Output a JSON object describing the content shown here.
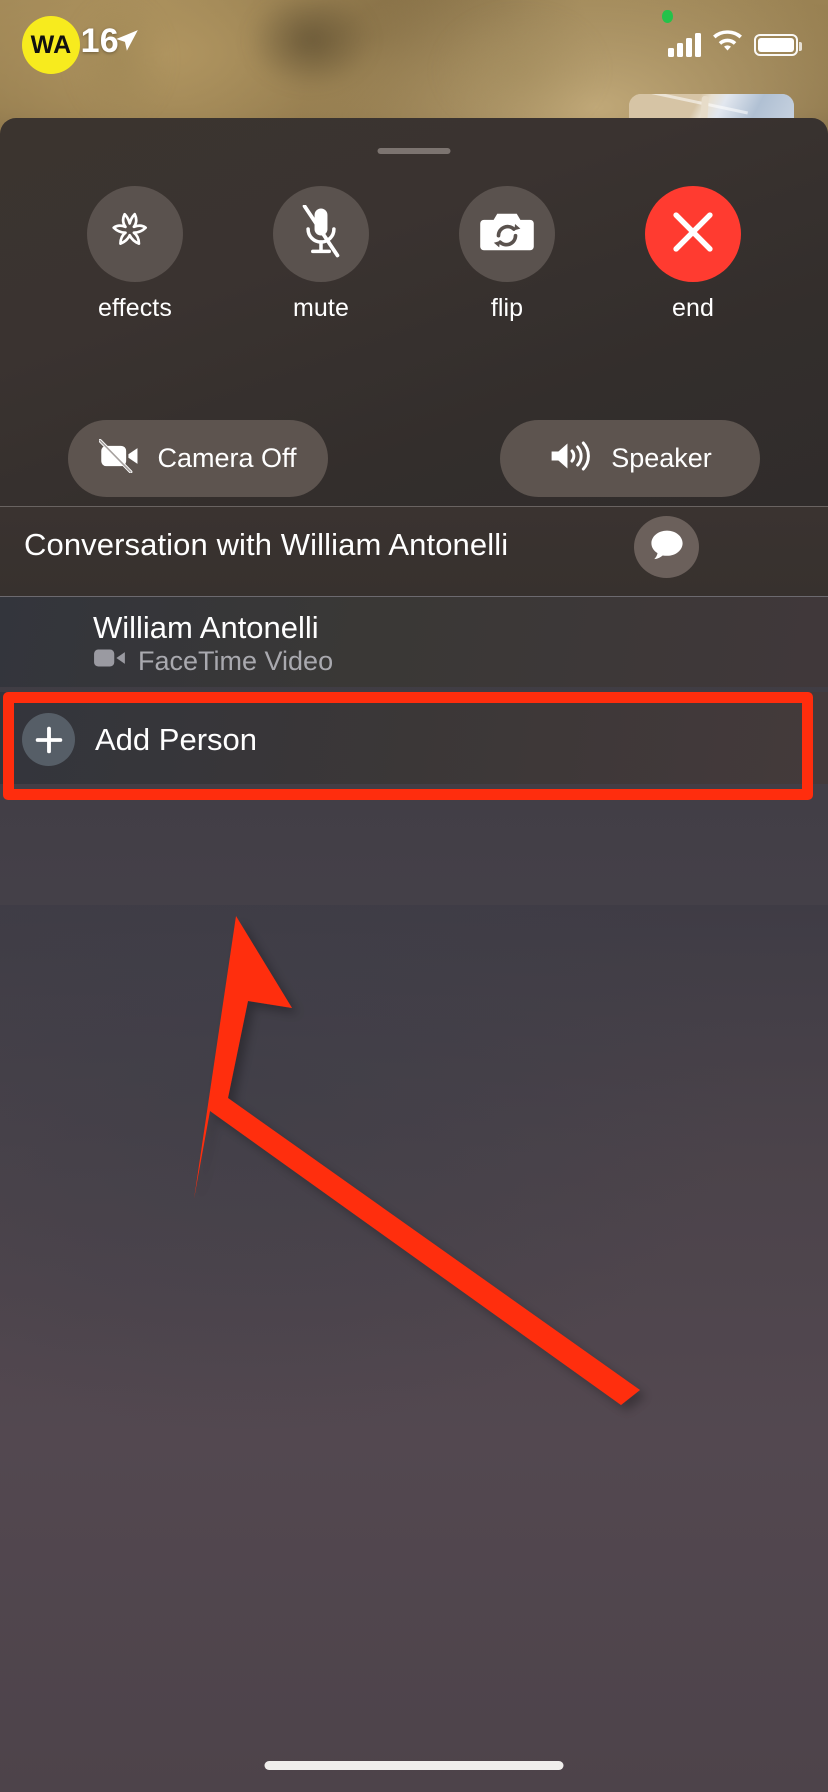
{
  "status_bar": {
    "time": "5:16",
    "location_icon": "location-arrow-icon",
    "recording_indicator": "green-recording-dot",
    "cellular_icon": "signal-bars-icon",
    "wifi_icon": "wifi-icon",
    "battery_icon": "battery-full-icon"
  },
  "pip": {
    "label": "self-view-preview"
  },
  "controls": {
    "handle": "drag-handle",
    "buttons": [
      {
        "id": "effects",
        "label": "effects",
        "icon": "star-effects-icon",
        "style": "neutral"
      },
      {
        "id": "mute",
        "label": "mute",
        "icon": "microphone-slash-icon",
        "style": "neutral"
      },
      {
        "id": "flip",
        "label": "flip",
        "icon": "camera-rotate-icon",
        "style": "neutral"
      },
      {
        "id": "end",
        "label": "end",
        "icon": "close-x-icon",
        "style": "danger"
      }
    ],
    "toggles": [
      {
        "id": "camera-off",
        "label": "Camera Off",
        "icon": "video-slash-icon"
      },
      {
        "id": "speaker",
        "label": "Speaker",
        "icon": "speaker-waves-icon"
      }
    ]
  },
  "conversation": {
    "title": "Conversation with William Antonelli",
    "message_button_icon": "message-bubble-icon"
  },
  "participants": [
    {
      "initials": "WA",
      "name": "William Antonelli",
      "status": "FaceTime Video",
      "status_icon": "video-camera-icon"
    }
  ],
  "add_person": {
    "label": "Add Person",
    "icon": "plus-icon"
  },
  "annotation": {
    "highlight_target": "Add Person",
    "arrow_color": "#ff2d0d",
    "box_color": "#ff2d0d"
  },
  "home_indicator": "home-indicator-bar",
  "colors": {
    "end_button": "#ff3b30",
    "avatar": "#f7eb1e",
    "annotation": "#ff2d0d",
    "recording_dot": "#24c24a"
  }
}
